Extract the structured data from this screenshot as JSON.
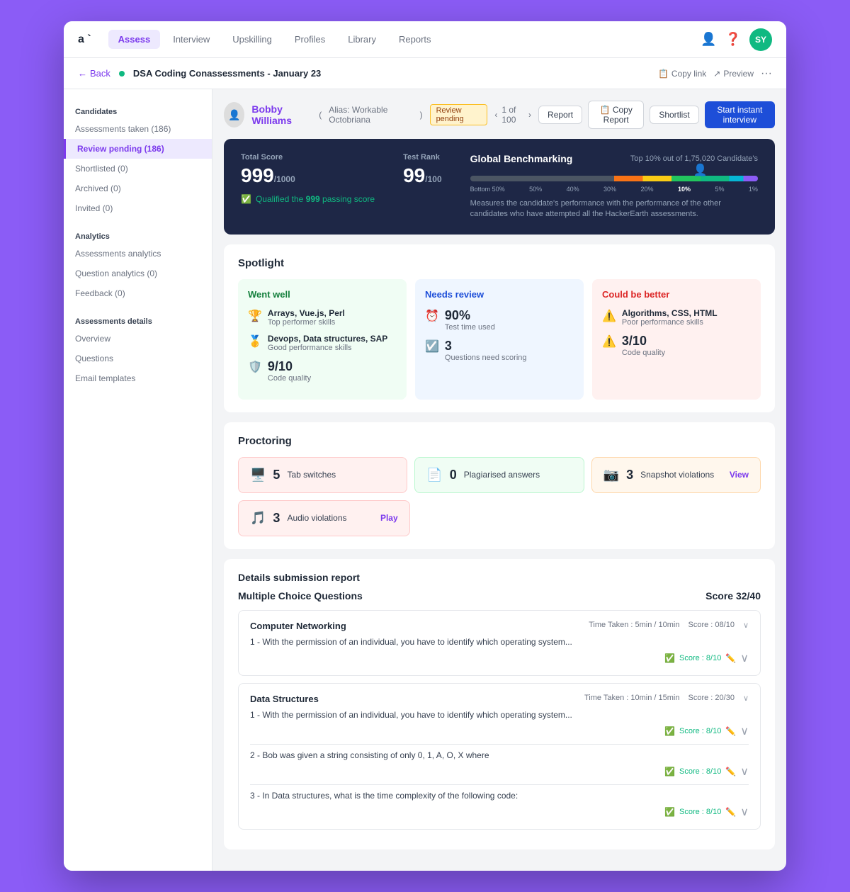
{
  "app": {
    "logo": "a `",
    "nav": {
      "items": [
        {
          "label": "Assess",
          "active": true
        },
        {
          "label": "Interview",
          "active": false
        },
        {
          "label": "Upskilling",
          "active": false
        },
        {
          "label": "Profiles",
          "active": false
        },
        {
          "label": "Library",
          "active": false
        },
        {
          "label": "Reports",
          "active": false
        }
      ]
    },
    "avatar": "SY"
  },
  "subnav": {
    "back_label": "Back",
    "assessment_title": "DSA Coding Conassessments - January 23",
    "copy_link": "Copy link",
    "preview": "Preview"
  },
  "sidebar": {
    "candidates_title": "Candidates",
    "items": [
      {
        "label": "Assessments taken (186)",
        "active": false
      },
      {
        "label": "Review pending (186)",
        "active": true
      },
      {
        "label": "Shortlisted (0)",
        "active": false
      },
      {
        "label": "Archived (0)",
        "active": false
      },
      {
        "label": "Invited (0)",
        "active": false
      }
    ],
    "analytics_title": "Analytics",
    "analytics_items": [
      {
        "label": "Assessments analytics",
        "active": false
      },
      {
        "label": "Question analytics (0)",
        "active": false
      },
      {
        "label": "Feedback (0)",
        "active": false
      }
    ],
    "details_title": "Assessments details",
    "details_items": [
      {
        "label": "Overview",
        "active": false
      },
      {
        "label": "Questions",
        "active": false
      },
      {
        "label": "Email templates",
        "active": false
      }
    ]
  },
  "candidate": {
    "name": "Bobby Williams",
    "alias": "Alias: Workable Octobriana",
    "status": "Review pending",
    "pagination": "1 of 100",
    "actions": {
      "report": "Report",
      "copy_report": "Copy Report",
      "shortlist": "Shortlist",
      "start_interview": "Start instant interview"
    }
  },
  "score_card": {
    "total_score_label": "Total Score",
    "total_score": "999",
    "total_max": "1000",
    "test_rank_label": "Test Rank",
    "test_rank": "99",
    "test_rank_max": "100",
    "qualify_text": "Qualified the",
    "qualify_score": "999",
    "qualify_suffix": "passing score",
    "benchmarking_title": "Global Benchmarking",
    "benchmarking_top": "Top 10% out of 1,75,020 Candidate's",
    "bench_labels": [
      "Bottom 50%",
      "50%",
      "40%",
      "30%",
      "20%",
      "10%",
      "5%",
      "1%"
    ],
    "bench_desc": "Measures the candidate's performance with the performance of the other candidates who have attempted all the HackerEarth assessments."
  },
  "spotlight": {
    "title": "Spotlight",
    "went_well": {
      "heading": "Went well",
      "skills1": "Arrays, Vue.js, Perl",
      "skills1_label": "Top performer skills",
      "skills2": "Devops, Data structures, SAP",
      "skills2_label": "Good performance skills",
      "code_quality": "9/10",
      "code_quality_label": "Code quality"
    },
    "needs_review": {
      "heading": "Needs review",
      "time_percent": "90%",
      "time_label": "Test time used",
      "questions_num": "3",
      "questions_label": "Questions need scoring"
    },
    "could_be_better": {
      "heading": "Could be better",
      "skills": "Algorithms, CSS, HTML",
      "skills_label": "Poor performance skills",
      "code_quality": "3/10",
      "code_quality_label": "Code quality"
    }
  },
  "proctoring": {
    "title": "Proctoring",
    "tab_switches": {
      "num": "5",
      "label": "Tab switches"
    },
    "plagiarised": {
      "num": "0",
      "label": "Plagiarised answers"
    },
    "snapshot": {
      "num": "3",
      "label": "Snapshot violations",
      "action": "View"
    },
    "audio": {
      "num": "3",
      "label": "Audio violations",
      "action": "Play"
    }
  },
  "details": {
    "title": "Details submission report",
    "mcq_title": "Multiple Choice Questions",
    "mcq_score": "Score 32/40",
    "sections": [
      {
        "title": "Computer Networking",
        "time_taken": "Time Taken : 5min / 10min",
        "score": "Score : 08/10",
        "questions": [
          {
            "text": "1 - With the permission of an individual, you have to identify which operating system...",
            "score": "Score : 8/10"
          }
        ]
      },
      {
        "title": "Data Structures",
        "time_taken": "Time Taken : 10min / 15min",
        "score": "Score : 20/30",
        "questions": [
          {
            "text": "1 - With the permission of an individual, you have to identify which operating system...",
            "score": "Score : 8/10"
          },
          {
            "text": "2 - Bob was given a string consisting of only 0, 1, A, O, X where",
            "score": "Score : 8/10"
          },
          {
            "text": "3 - In Data structures, what is the time complexity of the following code:",
            "score": "Score : 8/10"
          }
        ]
      }
    ]
  }
}
